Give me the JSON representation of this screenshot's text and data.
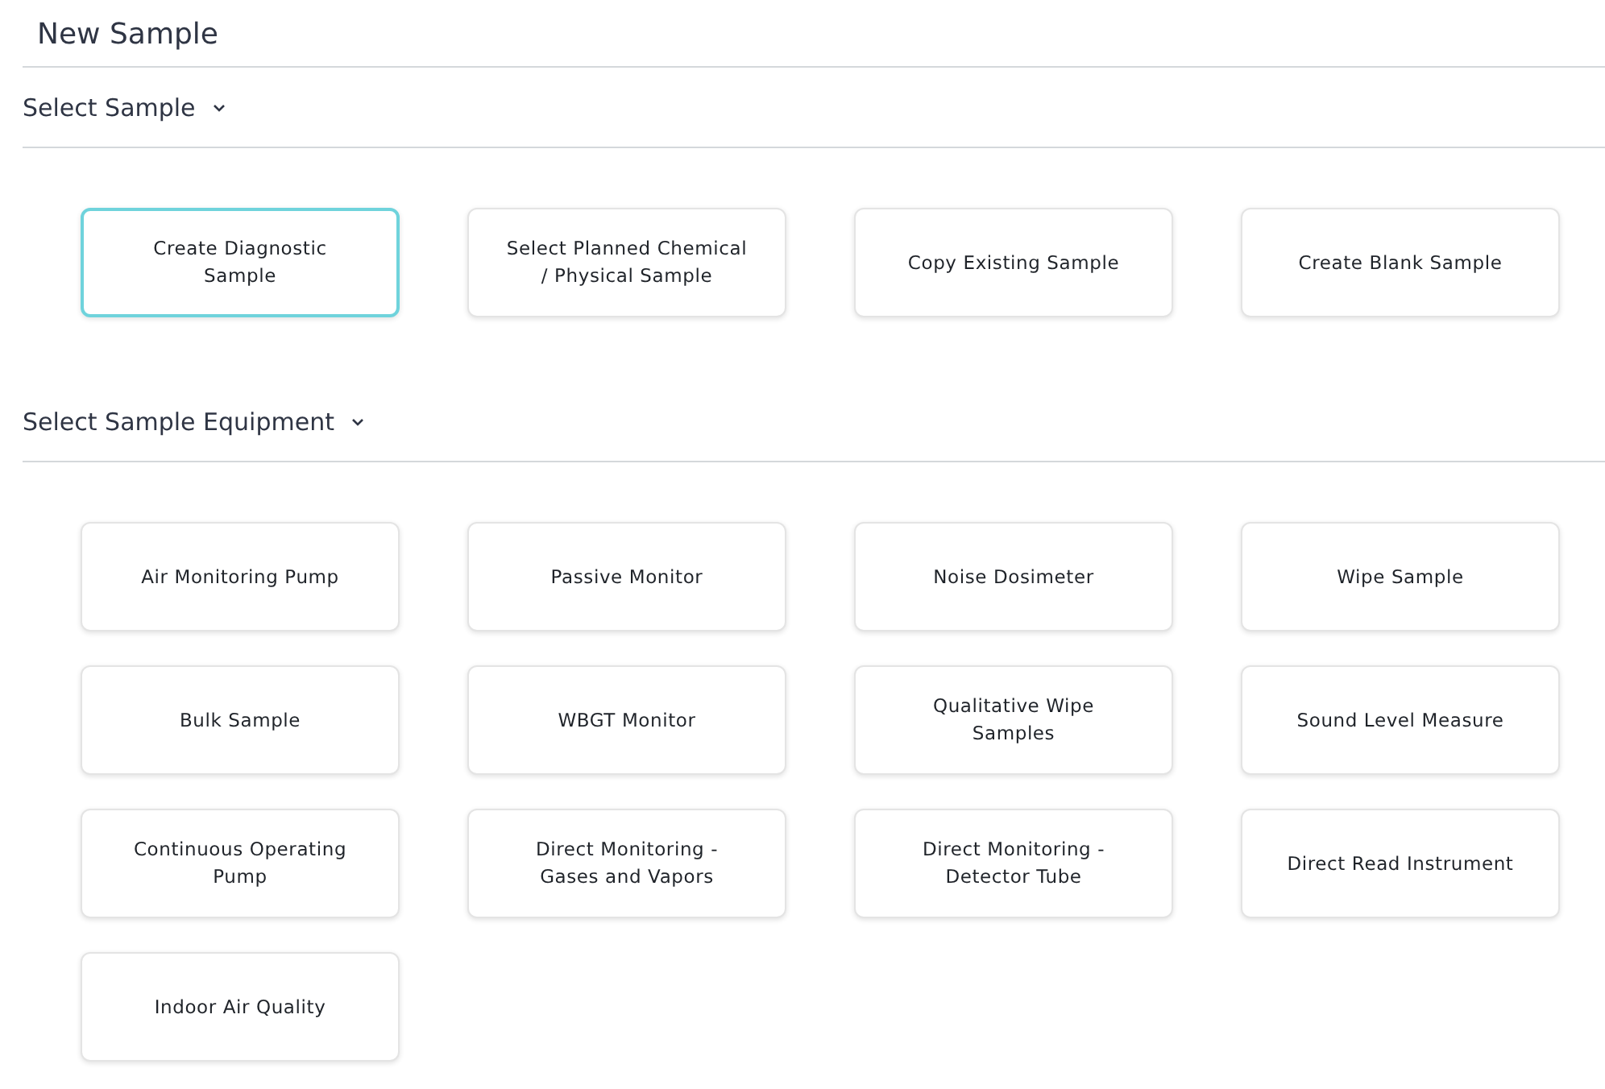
{
  "title": "New Sample",
  "sections": [
    {
      "heading": "Select Sample",
      "expanded": true,
      "cards": [
        {
          "label": "Create Diagnostic Sample",
          "selected": true
        },
        {
          "label": "Select Planned Chemical / Physical Sample",
          "selected": false
        },
        {
          "label": "Copy Existing Sample",
          "selected": false
        },
        {
          "label": "Create Blank Sample",
          "selected": false
        }
      ]
    },
    {
      "heading": "Select Sample Equipment",
      "expanded": true,
      "cards": [
        {
          "label": "Air Monitoring Pump",
          "selected": false
        },
        {
          "label": "Passive Monitor",
          "selected": false
        },
        {
          "label": "Noise Dosimeter",
          "selected": false
        },
        {
          "label": "Wipe Sample",
          "selected": false
        },
        {
          "label": "Bulk Sample",
          "selected": false
        },
        {
          "label": "WBGT Monitor",
          "selected": false
        },
        {
          "label": "Qualitative Wipe Samples",
          "selected": false
        },
        {
          "label": "Sound Level Measure",
          "selected": false
        },
        {
          "label": "Continuous Operating Pump",
          "selected": false
        },
        {
          "label": "Direct Monitoring - Gases and Vapors",
          "selected": false
        },
        {
          "label": "Direct Monitoring - Detector Tube",
          "selected": false
        },
        {
          "label": "Direct Read Instrument",
          "selected": false
        },
        {
          "label": "Indoor Air Quality",
          "selected": false
        }
      ]
    }
  ]
}
